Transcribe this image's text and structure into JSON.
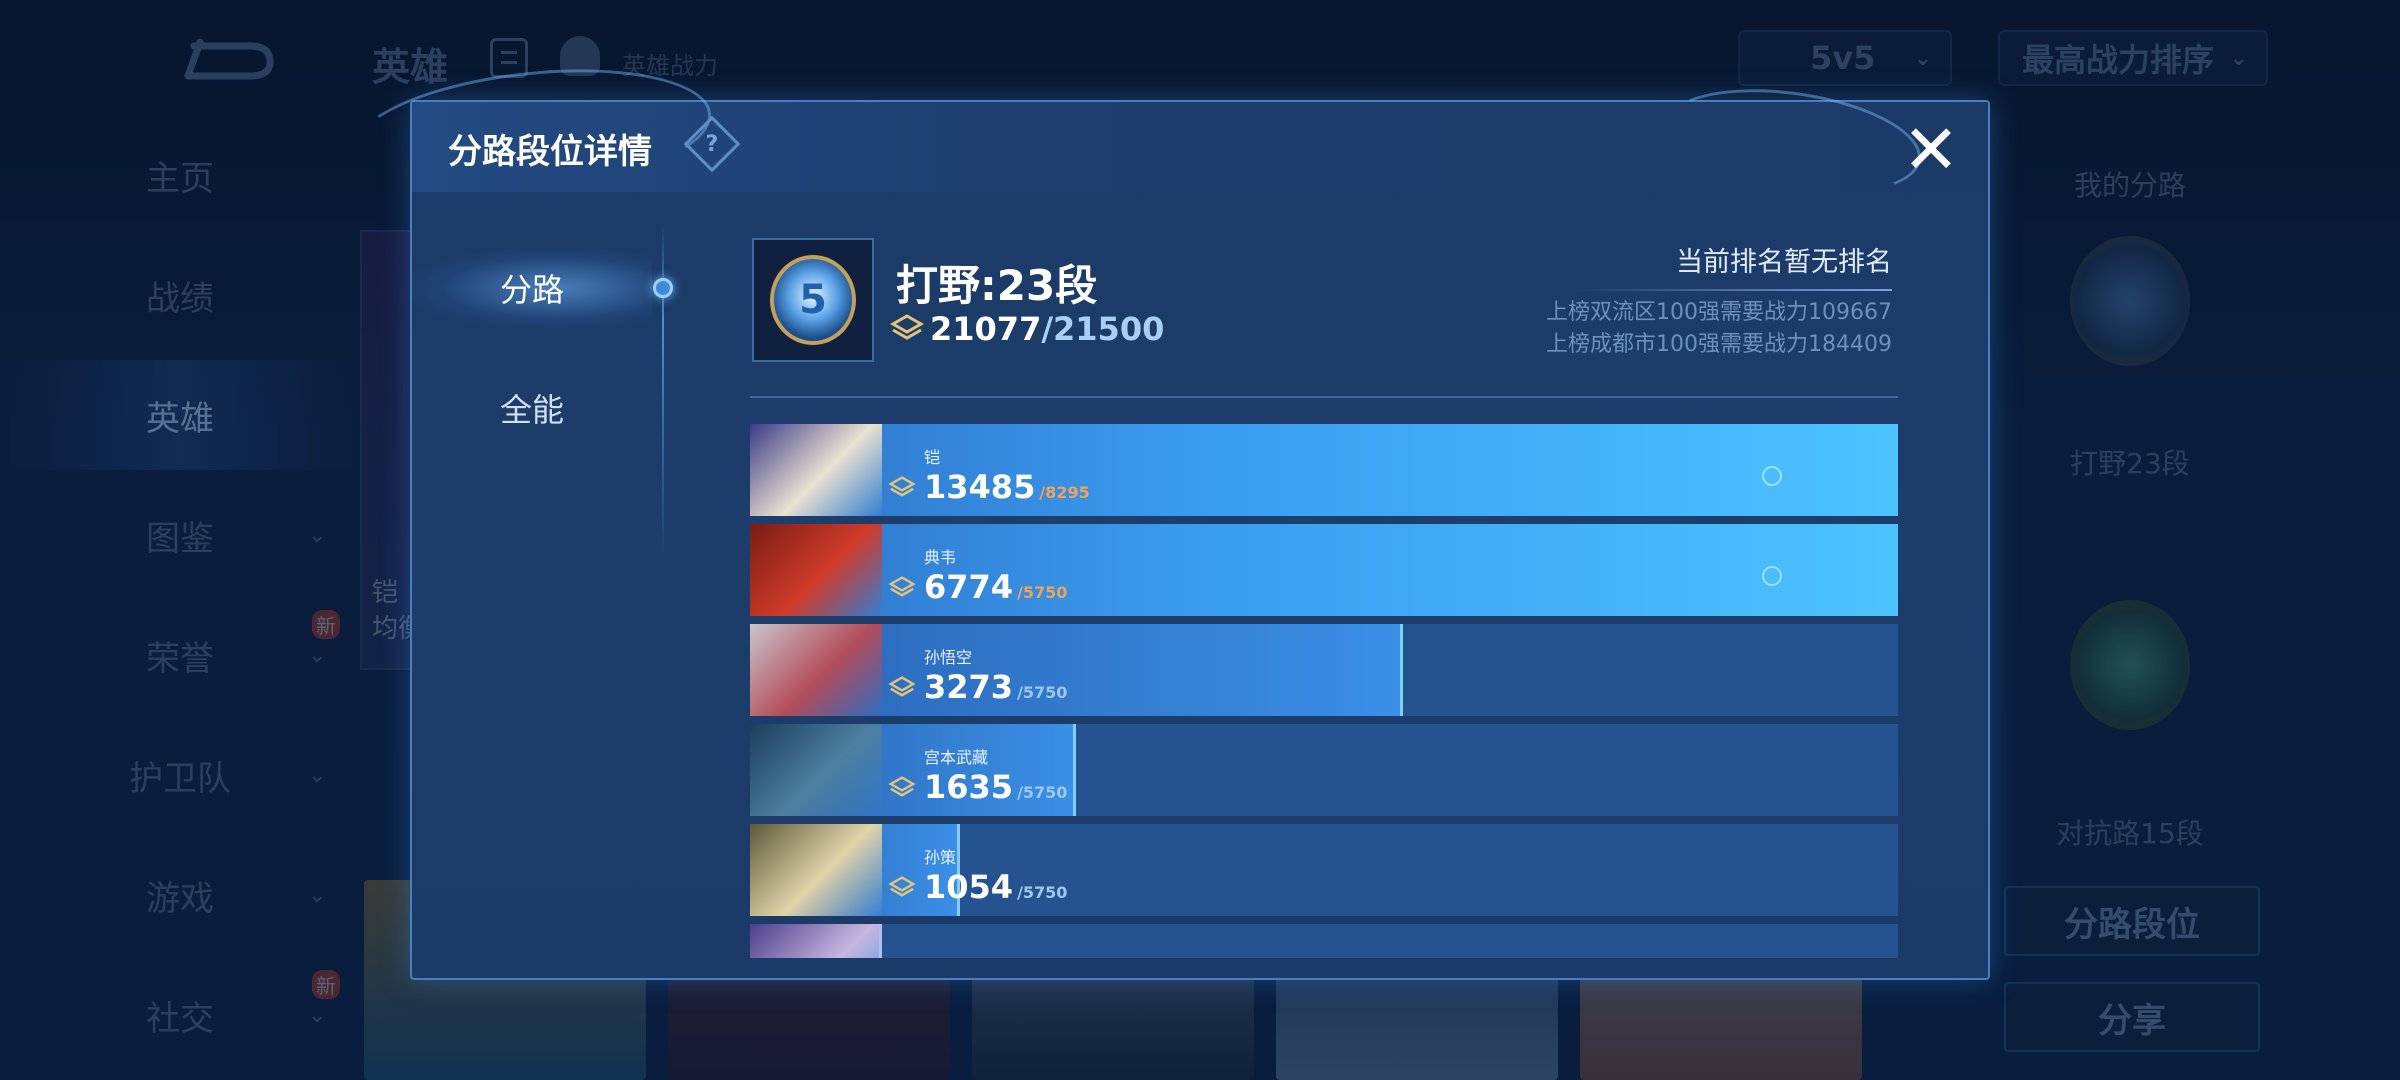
{
  "background": {
    "title": "英雄",
    "power_label": "英雄战力",
    "mode_dropdown": "5v5",
    "sort_dropdown": "最高战力排序",
    "sidebar": [
      {
        "label": "主页",
        "chevron": false,
        "badge": ""
      },
      {
        "label": "战绩",
        "chevron": false,
        "badge": ""
      },
      {
        "label": "英雄",
        "chevron": false,
        "badge": "",
        "active": true
      },
      {
        "label": "图鉴",
        "chevron": true,
        "badge": ""
      },
      {
        "label": "荣誉",
        "chevron": true,
        "badge": "新"
      },
      {
        "label": "护卫队",
        "chevron": true,
        "badge": ""
      },
      {
        "label": "游戏",
        "chevron": true,
        "badge": ""
      },
      {
        "label": "社交",
        "chevron": true,
        "badge": "新"
      }
    ],
    "right_panel": {
      "my_lane_label": "我的分路",
      "lane1_label": "打野23段",
      "lane2_label": "对抗路15段",
      "lane_rank_button": "分路段位",
      "share_button": "分享"
    },
    "partial_hero_text": [
      "铠",
      "均衡"
    ]
  },
  "modal": {
    "title": "分路段位详情",
    "help_icon": "?",
    "close_icon": "✕",
    "tabs": [
      {
        "label": "分路",
        "active": true
      },
      {
        "label": "全能",
        "active": false
      }
    ],
    "lane": {
      "title": "打野:23段",
      "current_power": "21077",
      "separator": "/",
      "target_power": "21500"
    },
    "rank": {
      "status": "当前排名暂无排名",
      "requirement_1": "上榜双流区100强需要战力109667",
      "requirement_2": "上榜成都市100强需要战力184409"
    },
    "heroes": [
      {
        "name": "铠",
        "power": "13485",
        "target": "/8295",
        "target_color": "#f2a35a",
        "fill": 1.0,
        "colors": [
          "#3b3a8a",
          "#e9e2d0"
        ]
      },
      {
        "name": "典韦",
        "power": "6774",
        "target": "/5750",
        "target_color": "#f2a35a",
        "fill": 1.0,
        "colors": [
          "#7a1c14",
          "#d13b2a"
        ]
      },
      {
        "name": "孙悟空",
        "power": "3273",
        "target": "/5750",
        "target_color": "#9ec8f0",
        "fill": 0.569,
        "colors": [
          "#c9c4cc",
          "#b34d5a"
        ]
      },
      {
        "name": "宫本武藏",
        "power": "1635",
        "target": "/5750",
        "target_color": "#9ec8f0",
        "fill": 0.284,
        "colors": [
          "#1d3f5c",
          "#4d7fa0"
        ]
      },
      {
        "name": "孙策",
        "power": "1054",
        "target": "/5750",
        "target_color": "#9ec8f0",
        "fill": 0.183,
        "colors": [
          "#5c5a3a",
          "#e0d3a8"
        ]
      },
      {
        "name": "",
        "power": "",
        "target": "",
        "target_color": "#9ec8f0",
        "fill": 0.1,
        "colors": [
          "#4b3f8a",
          "#c6b7e0"
        ]
      }
    ]
  }
}
